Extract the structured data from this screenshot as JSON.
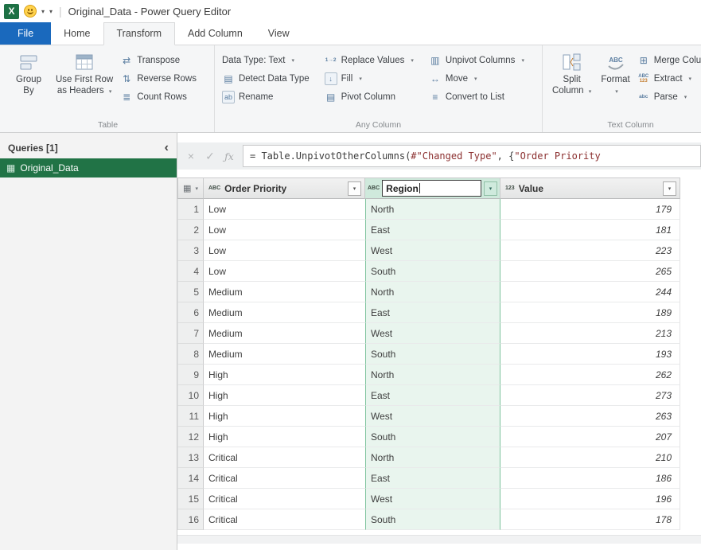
{
  "titlebar": {
    "title": "Original_Data - Power Query Editor"
  },
  "icons": {
    "excel": "X",
    "caret": "▾",
    "collapse": "‹",
    "sep": "|",
    "cancel": "×",
    "check": "✓",
    "fx": "ƒx",
    "grid": "▦",
    "type_text": "ABC",
    "type_number": "123",
    "transpose": "⇄",
    "reverse_rows": "⇅",
    "count_rows": "≣",
    "detect_data_type": "▤",
    "rename": "ab",
    "replace_values": "1→2",
    "fill": "↓",
    "pivot_column": "▤",
    "unpivot_columns": "▥",
    "move": "↔",
    "convert_to_list": "≡",
    "merge_columns": "⊞",
    "extract_top": "ABC",
    "extract_bottom": "123",
    "parse": "abc",
    "query_table": "▦"
  },
  "tabs": {
    "file": "File",
    "home": "Home",
    "transform": "Transform",
    "add_column": "Add Column",
    "view": "View"
  },
  "ribbon": {
    "table_group": {
      "label": "Table",
      "group_by": "Group By",
      "use_first_row_line1": "Use First Row",
      "use_first_row_line2": "as Headers",
      "transpose": "Transpose",
      "reverse_rows": "Reverse Rows",
      "count_rows": "Count Rows"
    },
    "any_column_group": {
      "label": "Any Column",
      "data_type": "Data Type: Text",
      "detect_data_type": "Detect Data Type",
      "rename": "Rename",
      "replace_values": "Replace Values",
      "fill": "Fill",
      "pivot_column": "Pivot Column",
      "unpivot_columns": "Unpivot Columns",
      "move": "Move",
      "convert_to_list": "Convert to List"
    },
    "text_column_group": {
      "label": "Text Column",
      "split_line1": "Split",
      "split_line2": "Column",
      "format": "Format",
      "merge_columns": "Merge Colu",
      "extract": "Extract",
      "parse": "Parse"
    }
  },
  "queries_panel": {
    "header": "Queries [1]",
    "query_name": "Original_Data"
  },
  "formula_bar": {
    "parts": [
      {
        "kind": "code",
        "text": "= Table.UnpivotOtherColumns("
      },
      {
        "kind": "string",
        "text": "#\"Changed Type\""
      },
      {
        "kind": "code",
        "text": ", {"
      },
      {
        "kind": "string",
        "text": "\"Order Priority"
      }
    ]
  },
  "table": {
    "columns": [
      {
        "name": "Order Priority",
        "type": "text"
      },
      {
        "name": "Region",
        "type": "text",
        "editing": true
      },
      {
        "name": "Value",
        "type": "number"
      }
    ],
    "rows": [
      [
        "1",
        "Low",
        "North",
        "179"
      ],
      [
        "2",
        "Low",
        "East",
        "181"
      ],
      [
        "3",
        "Low",
        "West",
        "223"
      ],
      [
        "4",
        "Low",
        "South",
        "265"
      ],
      [
        "5",
        "Medium",
        "North",
        "244"
      ],
      [
        "6",
        "Medium",
        "East",
        "189"
      ],
      [
        "7",
        "Medium",
        "West",
        "213"
      ],
      [
        "8",
        "Medium",
        "South",
        "193"
      ],
      [
        "9",
        "High",
        "North",
        "262"
      ],
      [
        "10",
        "High",
        "East",
        "273"
      ],
      [
        "11",
        "High",
        "West",
        "263"
      ],
      [
        "12",
        "High",
        "South",
        "207"
      ],
      [
        "13",
        "Critical",
        "North",
        "210"
      ],
      [
        "14",
        "Critical",
        "East",
        "186"
      ],
      [
        "15",
        "Critical",
        "West",
        "196"
      ],
      [
        "16",
        "Critical",
        "South",
        "178"
      ]
    ]
  },
  "colors": {
    "file_tab": "#1a69bd",
    "query_selected": "#217346",
    "selected_column_bg": "#e9f5ee",
    "selected_column_border": "#7fc39e",
    "region_header_bg": "#cfe9dc"
  }
}
